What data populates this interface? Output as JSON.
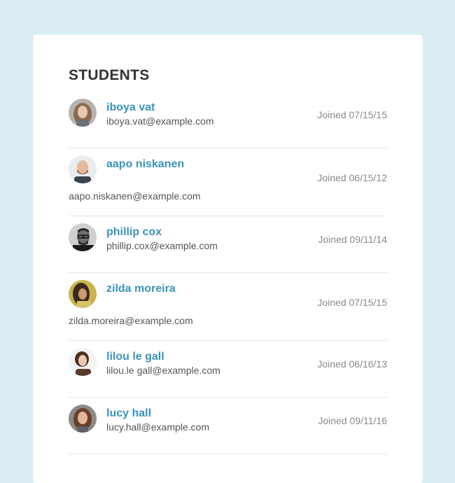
{
  "header": {
    "title": "STUDENTS"
  },
  "students": [
    {
      "name": "iboya vat",
      "email": "iboya.vat@example.com",
      "joined": "Joined 07/15/15",
      "avatar": "avatar-woman-light-hair",
      "layout": "short"
    },
    {
      "name": "aapo niskanen",
      "email": "aapo.niskanen@example.com",
      "joined": "Joined 06/15/12",
      "avatar": "avatar-man-bald",
      "layout": "tall"
    },
    {
      "name": "phillip cox",
      "email": "phillip.cox@example.com",
      "joined": "Joined 09/11/14",
      "avatar": "avatar-man-glasses",
      "layout": "short"
    },
    {
      "name": "zilda moreira",
      "email": "zilda.moreira@example.com",
      "joined": "Joined 07/15/15",
      "avatar": "avatar-woman-dark-hair",
      "layout": "tall"
    },
    {
      "name": "lilou le gall",
      "email": "lilou.le gall@example.com",
      "joined": "Joined 06/16/13",
      "avatar": "avatar-woman-brunette",
      "layout": "short"
    },
    {
      "name": "lucy hall",
      "email": "lucy.hall@example.com",
      "joined": "Joined 09/11/16",
      "avatar": "avatar-woman-curly-hair",
      "layout": "short"
    }
  ],
  "colors": {
    "background": "#d9edf3",
    "card": "#ffffff",
    "name_link": "#3b94b8",
    "title": "#333333",
    "meta": "#8a8a8a"
  }
}
